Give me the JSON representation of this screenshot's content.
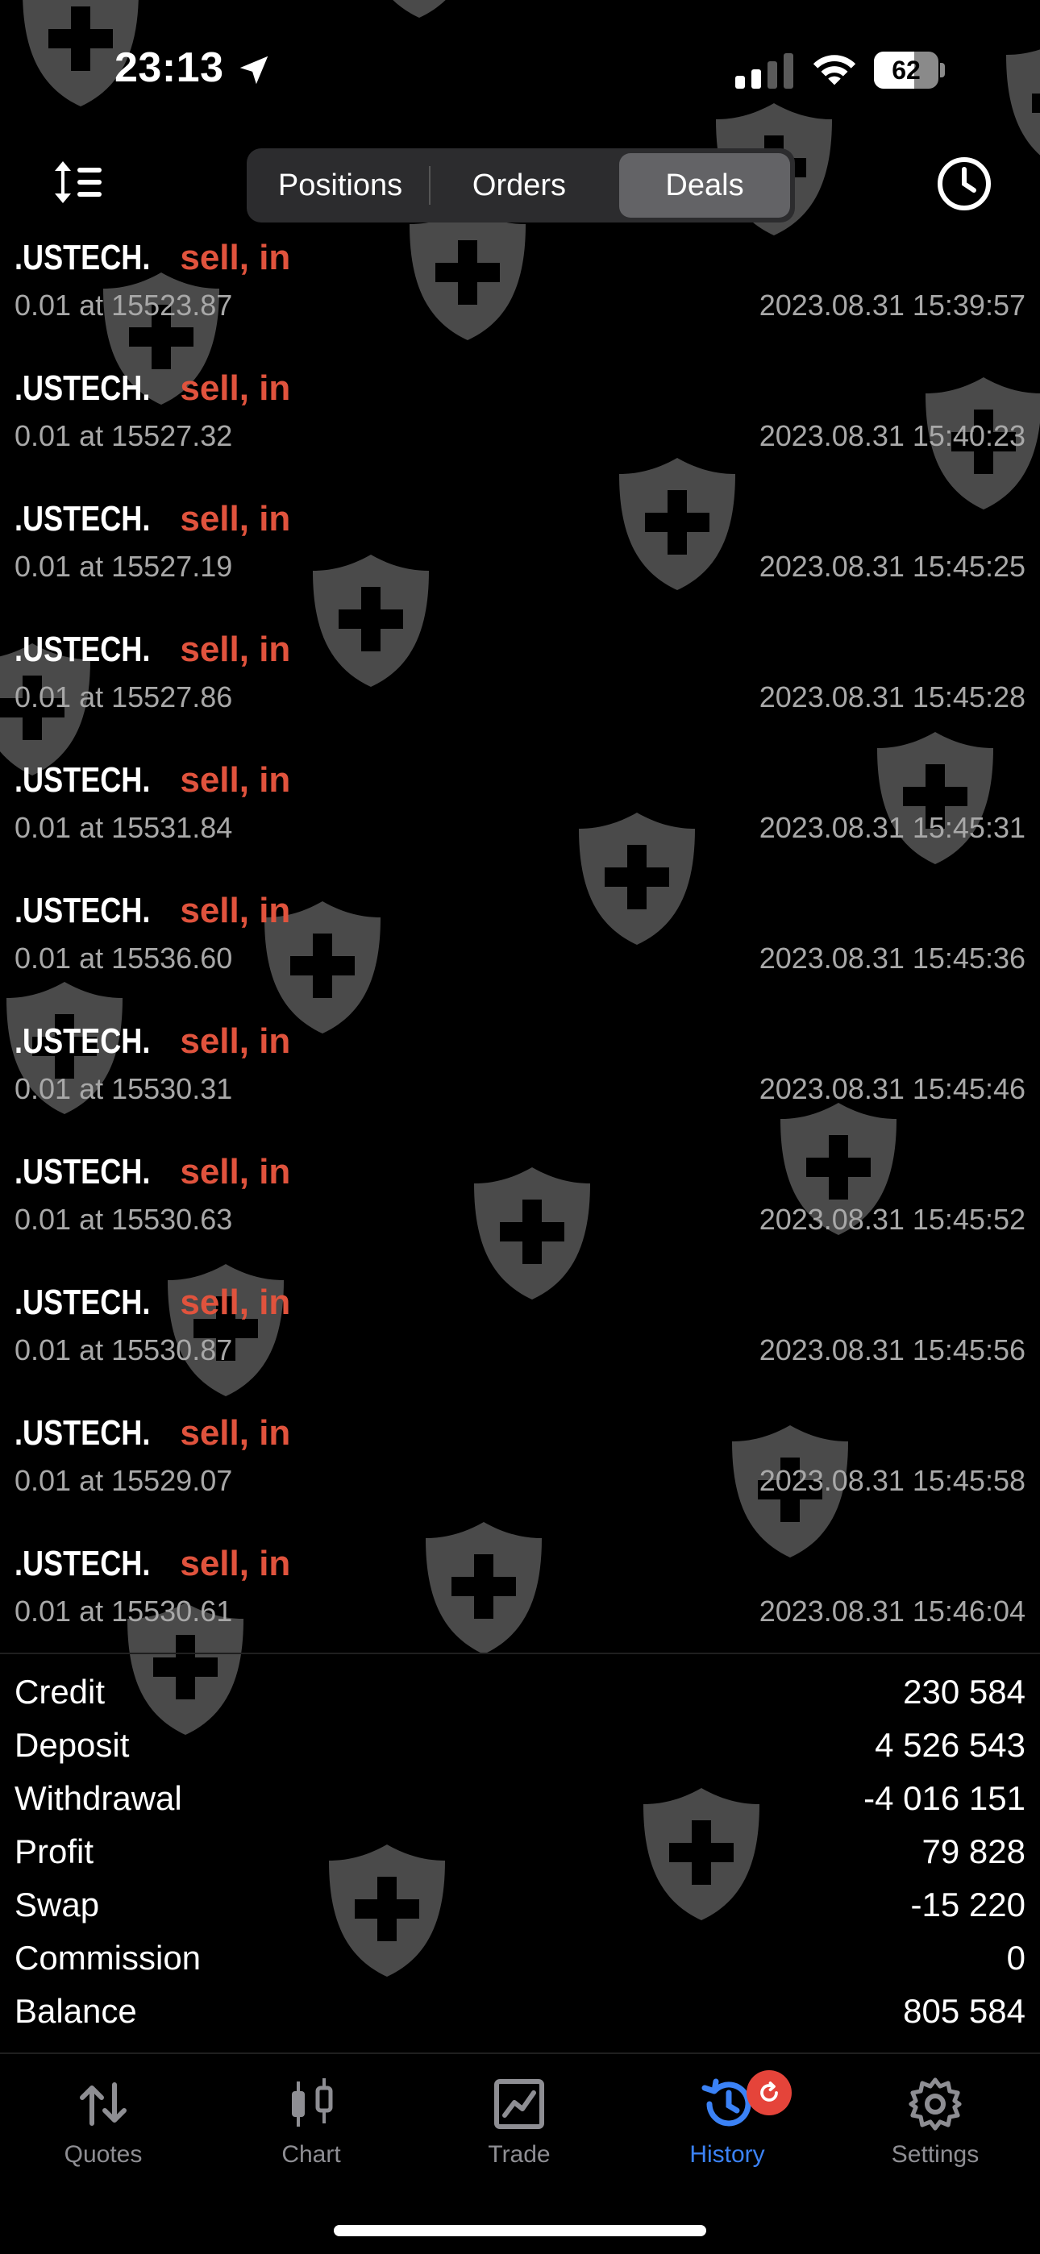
{
  "status_bar": {
    "time": "23:13",
    "battery_level": "62",
    "battery_fraction": 0.62,
    "icons": [
      "location-arrow-icon",
      "cellular-signal-icon",
      "wifi-icon",
      "battery-icon"
    ]
  },
  "toolbar": {
    "sort_icon": "sort-icon",
    "tabs": [
      "Positions",
      "Orders",
      "Deals"
    ],
    "selected_tab": "Deals",
    "history_icon": "clock-icon"
  },
  "deals": [
    {
      "symbol": ".USTECH.",
      "direction": "sell, in",
      "detail": "0.01 at 15523.87",
      "time": "2023.08.31 15:39:57"
    },
    {
      "symbol": ".USTECH.",
      "direction": "sell, in",
      "detail": "0.01 at 15527.32",
      "time": "2023.08.31 15:40:23"
    },
    {
      "symbol": ".USTECH.",
      "direction": "sell, in",
      "detail": "0.01 at 15527.19",
      "time": "2023.08.31 15:45:25"
    },
    {
      "symbol": ".USTECH.",
      "direction": "sell, in",
      "detail": "0.01 at 15527.86",
      "time": "2023.08.31 15:45:28"
    },
    {
      "symbol": ".USTECH.",
      "direction": "sell, in",
      "detail": "0.01 at 15531.84",
      "time": "2023.08.31 15:45:31"
    },
    {
      "symbol": ".USTECH.",
      "direction": "sell, in",
      "detail": "0.01 at 15536.60",
      "time": "2023.08.31 15:45:36"
    },
    {
      "symbol": ".USTECH.",
      "direction": "sell, in",
      "detail": "0.01 at 15530.31",
      "time": "2023.08.31 15:45:46"
    },
    {
      "symbol": ".USTECH.",
      "direction": "sell, in",
      "detail": "0.01 at 15530.63",
      "time": "2023.08.31 15:45:52"
    },
    {
      "symbol": ".USTECH.",
      "direction": "sell, in",
      "detail": "0.01 at 15530.87",
      "time": "2023.08.31 15:45:56"
    },
    {
      "symbol": ".USTECH.",
      "direction": "sell, in",
      "detail": "0.01 at 15529.07",
      "time": "2023.08.31 15:45:58"
    },
    {
      "symbol": ".USTECH.",
      "direction": "sell, in",
      "detail": "0.01 at 15530.61",
      "time": "2023.08.31 15:46:04"
    }
  ],
  "summary": [
    {
      "label": "Credit",
      "value": "230 584"
    },
    {
      "label": "Deposit",
      "value": "4 526 543"
    },
    {
      "label": "Withdrawal",
      "value": "-4 016 151"
    },
    {
      "label": "Profit",
      "value": "79 828"
    },
    {
      "label": "Swap",
      "value": "-15 220"
    },
    {
      "label": "Commission",
      "value": "0"
    },
    {
      "label": "Balance",
      "value": "805 584"
    }
  ],
  "tabbar": {
    "items": [
      {
        "label": "Quotes",
        "icon": "quotes-arrows-icon"
      },
      {
        "label": "Chart",
        "icon": "candlestick-chart-icon"
      },
      {
        "label": "Trade",
        "icon": "trade-chart-icon"
      },
      {
        "label": "History",
        "icon": "history-clock-icon"
      },
      {
        "label": "Settings",
        "icon": "gear-icon"
      }
    ],
    "active": "History",
    "badge_icon": "refresh-icon"
  },
  "colors": {
    "background": "#000000",
    "sell": "#e0533d",
    "muted_text": "#a8a8a8",
    "active_tab": "#3b82f6",
    "badge": "#e5443a",
    "watermark": "#4a4a4a"
  }
}
